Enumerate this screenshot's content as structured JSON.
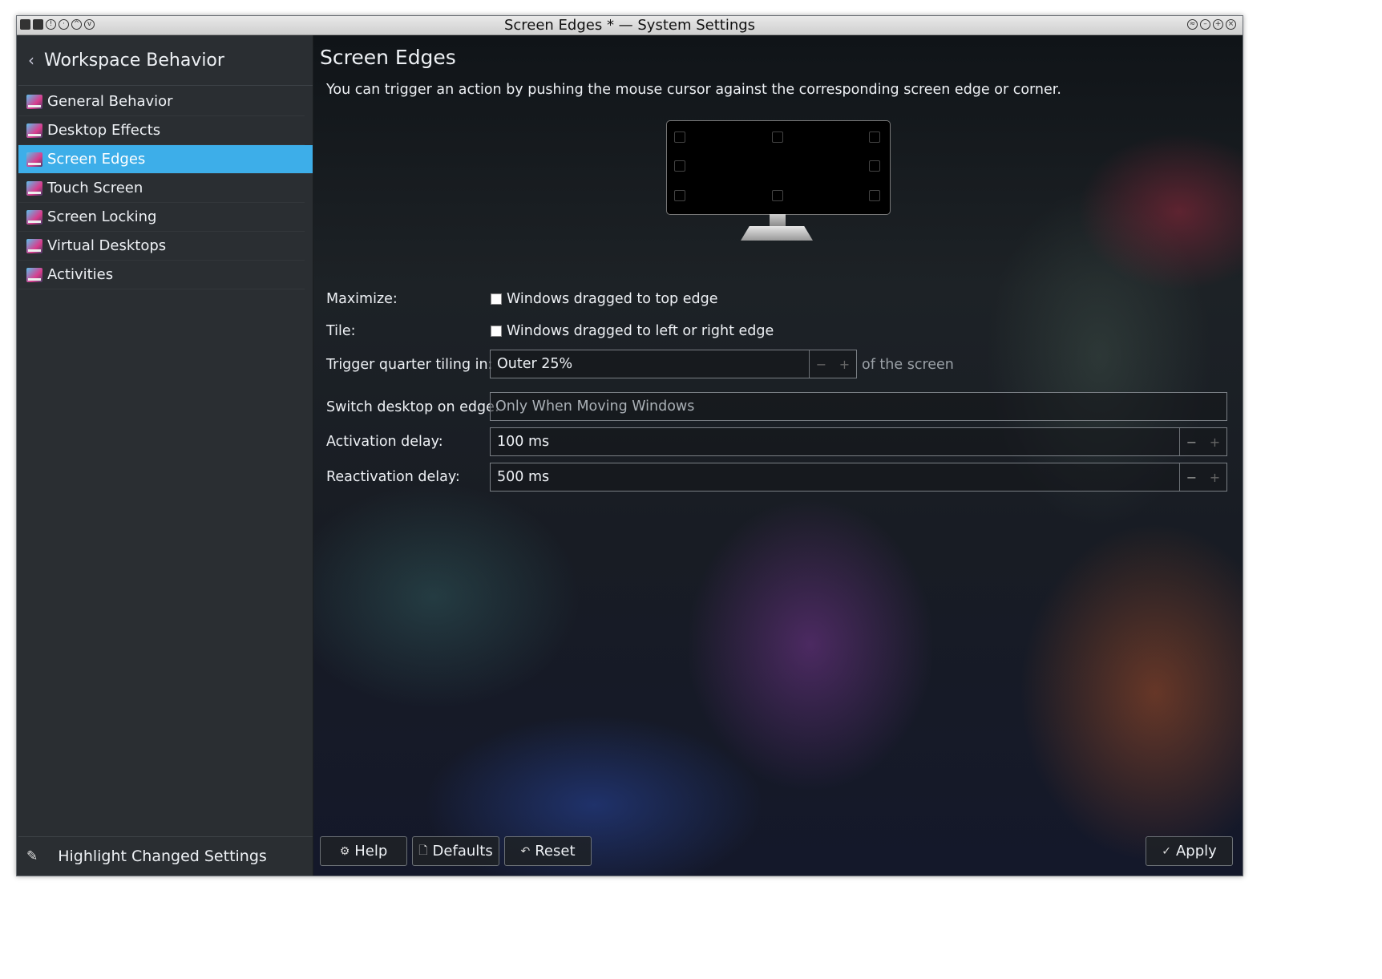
{
  "window": {
    "title": "Screen Edges * — System Settings",
    "left_controls": [
      "menu-icon",
      "keep-above-icon",
      "info-icon",
      "circle-icon",
      "shade-icon",
      "help-icon"
    ],
    "right_controls": [
      "keep-below-icon",
      "minimize-icon",
      "maximize-icon",
      "close-icon"
    ]
  },
  "sidebar": {
    "title": "Workspace Behavior",
    "items": [
      {
        "label": "General Behavior",
        "active": false
      },
      {
        "label": "Desktop Effects",
        "active": false
      },
      {
        "label": "Screen Edges",
        "active": true
      },
      {
        "label": "Touch Screen",
        "active": false
      },
      {
        "label": "Screen Locking",
        "active": false
      },
      {
        "label": "Virtual Desktops",
        "active": false
      },
      {
        "label": "Activities",
        "active": false
      }
    ],
    "footer_label": "Highlight Changed Settings"
  },
  "main": {
    "title": "Screen Edges",
    "description": "You can trigger an action by pushing the mouse cursor against the corresponding screen edge or corner.",
    "maximize": {
      "label": "Maximize:",
      "checkbox_label": "Windows dragged to top edge",
      "checked": false
    },
    "tile": {
      "label": "Tile:",
      "checkbox_label": "Windows dragged to left or right edge",
      "checked": false
    },
    "quarter_tiling": {
      "label": "Trigger quarter tiling in:",
      "value": "Outer 25%",
      "suffix": "of the screen"
    },
    "switch_desktop": {
      "label": "Switch desktop on edge:",
      "value": "Only When Moving Windows"
    },
    "activation_delay": {
      "label": "Activation delay:",
      "value": "100 ms"
    },
    "reactivation_delay": {
      "label": "Reactivation delay:",
      "value": "500 ms"
    }
  },
  "buttons": {
    "help": "Help",
    "defaults": "Defaults",
    "reset": "Reset",
    "apply": "Apply"
  },
  "colors": {
    "accent": "#3daee9",
    "sidebar_bg": "#2a2e32",
    "text": "#eef1f5"
  }
}
